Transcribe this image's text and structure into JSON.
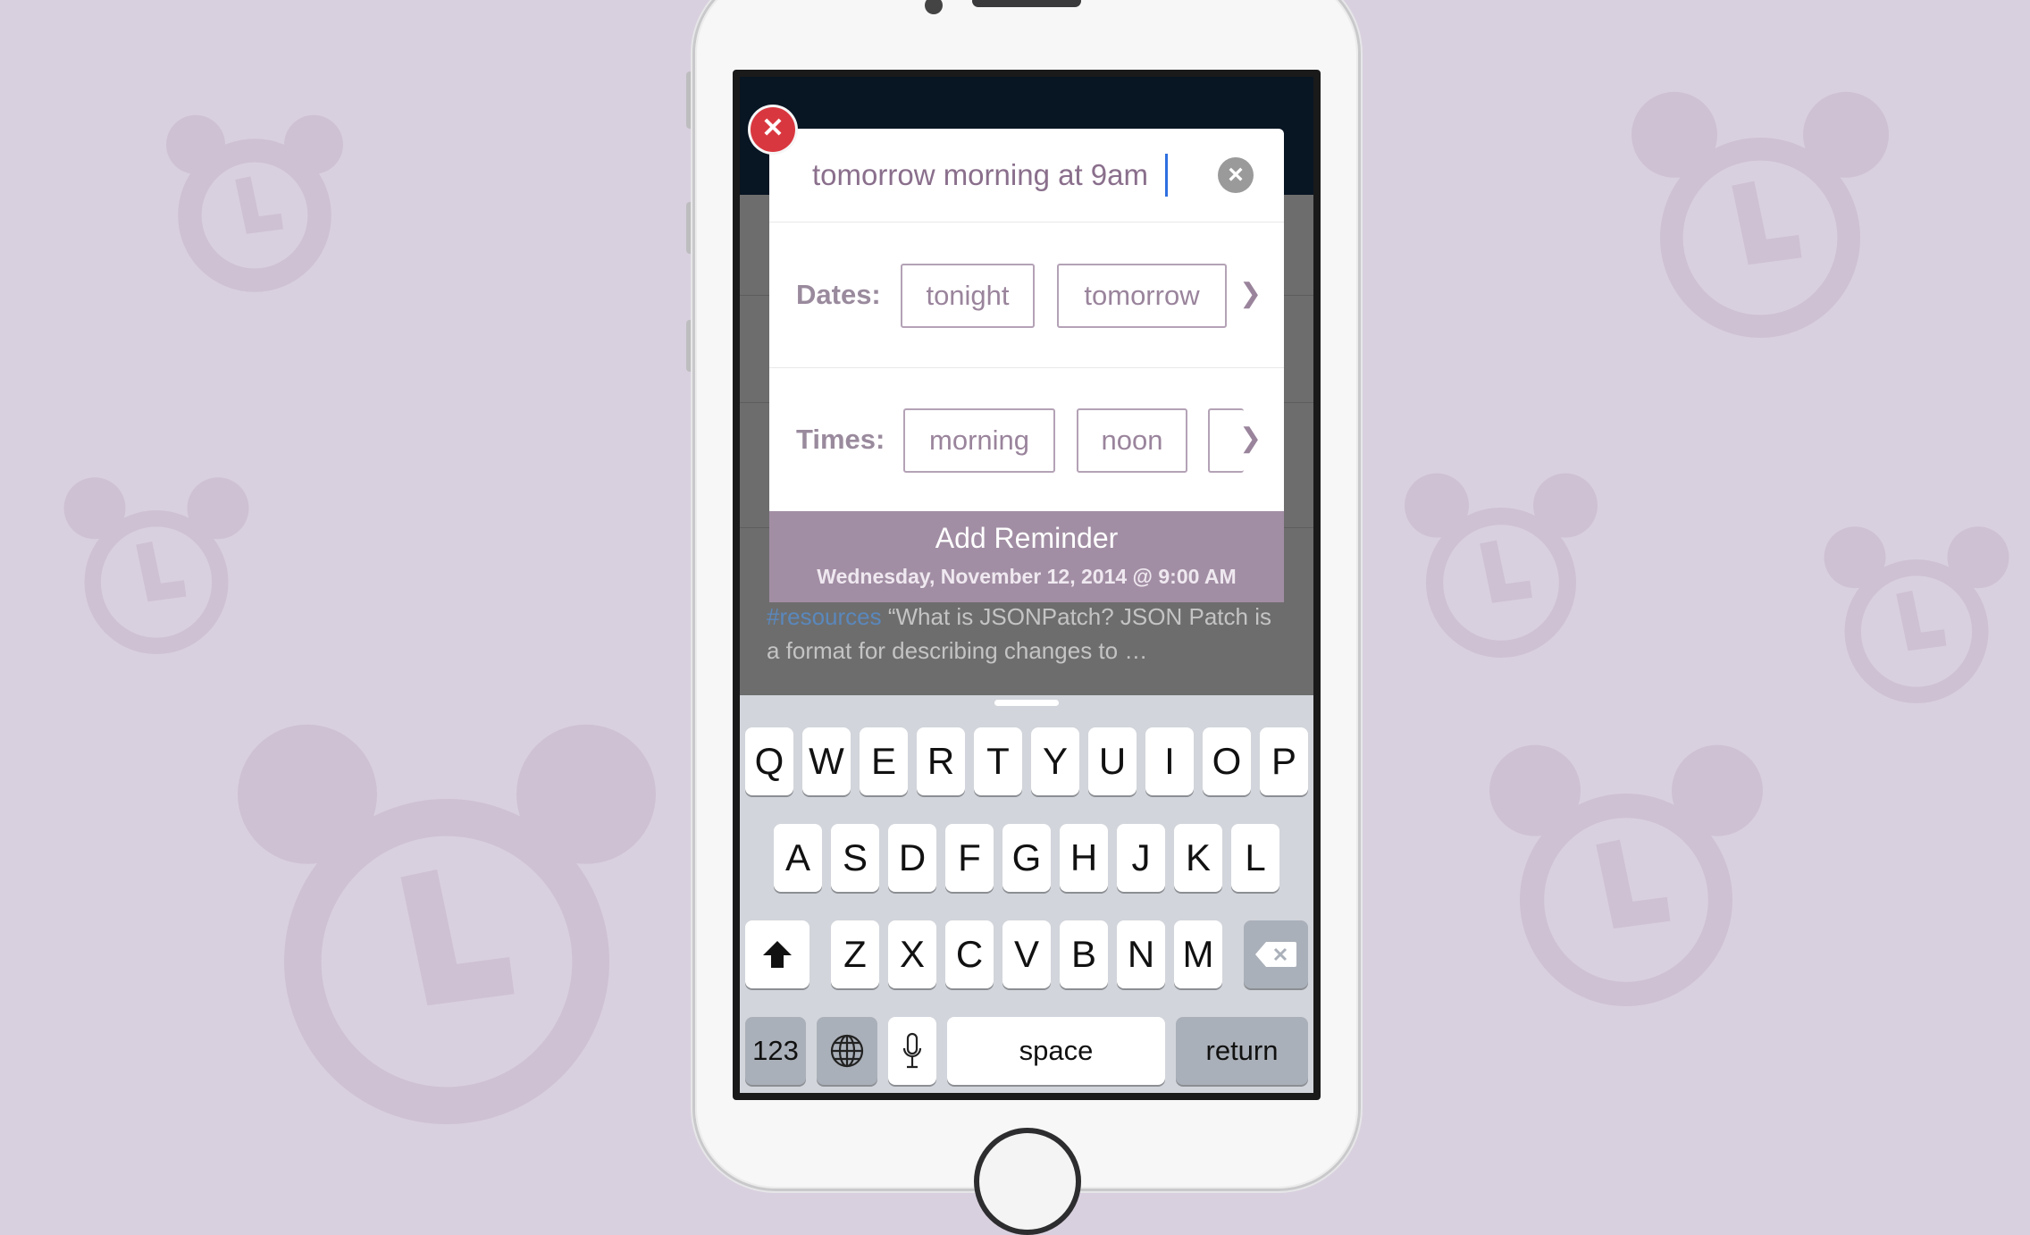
{
  "background": {
    "color": "#d9d0df",
    "icon": "alarm-clock-icon"
  },
  "app": {
    "snippet_tag": "#resources",
    "snippet_text": "“What is JSONPatch? JSON Patch is a format for describing changes to …"
  },
  "dialog": {
    "input_value": "tomorrow morning at 9am",
    "dates_label": "Dates:",
    "dates": [
      "tonight",
      "tomorrow"
    ],
    "times_label": "Times:",
    "times": [
      "morning",
      "noon"
    ],
    "add_button_title": "Add Reminder",
    "add_button_subtitle": "Wednesday, November 12, 2014 @ 9:00 AM",
    "accent_color": "#a28ea4",
    "close_color": "#d9373f"
  },
  "keyboard": {
    "row1": [
      "Q",
      "W",
      "E",
      "R",
      "T",
      "Y",
      "U",
      "I",
      "O",
      "P"
    ],
    "row2": [
      "A",
      "S",
      "D",
      "F",
      "G",
      "H",
      "J",
      "K",
      "L"
    ],
    "row3": [
      "Z",
      "X",
      "C",
      "V",
      "B",
      "N",
      "M"
    ],
    "numbers_key": "123",
    "space_key": "space",
    "return_key": "return"
  }
}
